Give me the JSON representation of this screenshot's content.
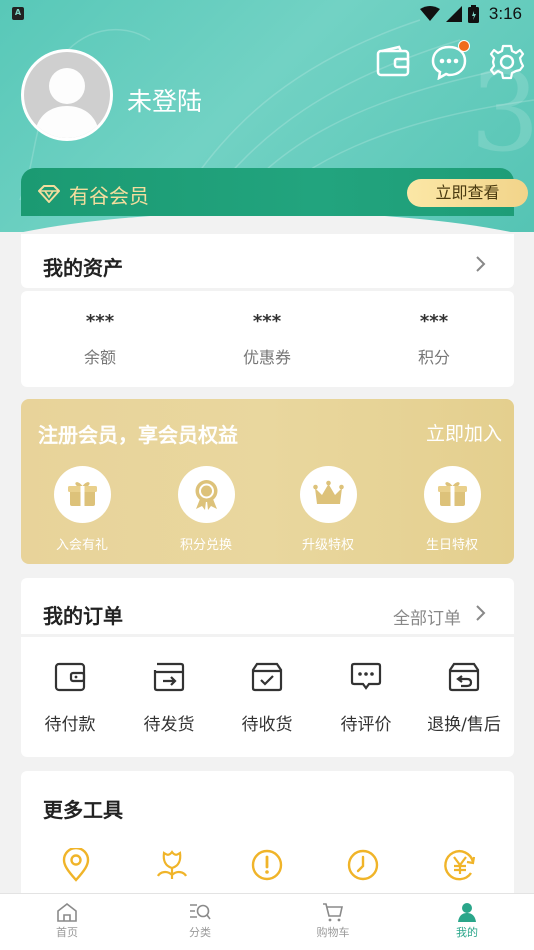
{
  "status_bar": {
    "time": "3:16"
  },
  "header": {
    "username": "未登陆"
  },
  "vip": {
    "label": "有谷会员",
    "button": "立即查看"
  },
  "assets": {
    "title": "我的资产",
    "items": [
      {
        "value": "***",
        "label": "余额"
      },
      {
        "value": "***",
        "label": "优惠券"
      },
      {
        "value": "***",
        "label": "积分"
      }
    ]
  },
  "member": {
    "title": "注册会员，享会员权益",
    "join": "立即加入",
    "perks": [
      {
        "label": "入会有礼",
        "icon": "gift-icon"
      },
      {
        "label": "积分兑换",
        "icon": "medal-icon"
      },
      {
        "label": "升级特权",
        "icon": "crown-icon"
      },
      {
        "label": "生日特权",
        "icon": "gift-icon"
      }
    ]
  },
  "orders": {
    "title": "我的订单",
    "all": "全部订单",
    "items": [
      {
        "label": "待付款",
        "icon": "wallet-icon"
      },
      {
        "label": "待发货",
        "icon": "outbox-icon"
      },
      {
        "label": "待收货",
        "icon": "box-check-icon"
      },
      {
        "label": "待评价",
        "icon": "comment-icon"
      },
      {
        "label": "退换/售后",
        "icon": "return-icon"
      }
    ]
  },
  "tools": {
    "title": "更多工具",
    "icons": [
      "location-icon",
      "flower-icon",
      "alert-icon",
      "clock-icon",
      "yen-exchange-icon"
    ]
  },
  "tabbar": {
    "tabs": [
      {
        "label": "首页",
        "icon": "home-icon"
      },
      {
        "label": "分类",
        "icon": "category-search-icon"
      },
      {
        "label": "购物车",
        "icon": "cart-icon"
      },
      {
        "label": "我的",
        "icon": "user-icon"
      }
    ],
    "active_index": 3
  },
  "colors": {
    "primary": "#2aa68a",
    "header": "#62cbbd",
    "gold": "#e8d39a",
    "accent": "#f0b429",
    "badge": "#f06c1c"
  }
}
